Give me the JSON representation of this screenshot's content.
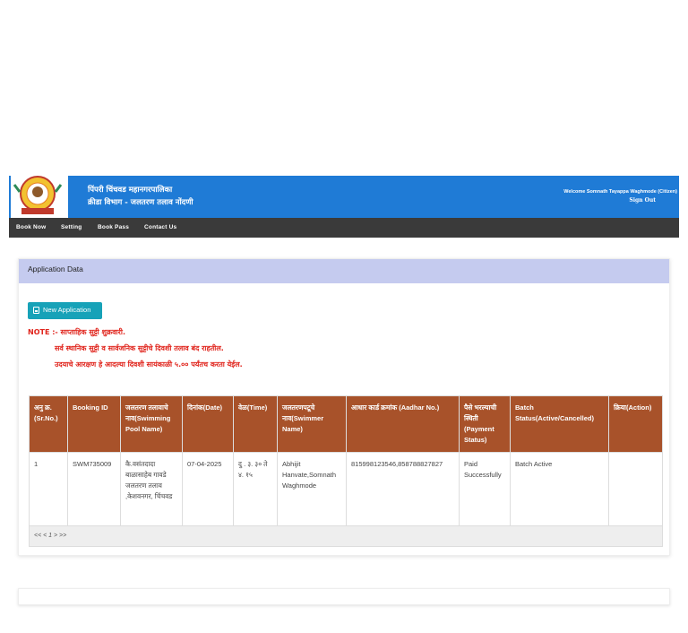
{
  "header": {
    "org_line1": "पिंपरी चिंचवड महानगरपालिका",
    "org_line2": "क्रीडा विभाग - जलतरण तलाव नोंदणी",
    "logo_text": "पिंपरी चिंचवड महानगरपालिका",
    "welcome": "Welcome Somnath Tayappa Waghmode (Citizen)",
    "signout": "Sign Out",
    "color": "#1f7bd6"
  },
  "nav": {
    "items": [
      "Book Now",
      "Setting",
      "Book Pass",
      "Contact Us"
    ],
    "color": "#3a3a3a"
  },
  "card": {
    "title": "Application Data",
    "header_color": "#c5cbef",
    "new_button": "New Application",
    "notes": [
      "NOTE :- साप्ताहिक सुट्टी शुक्रवारी.",
      "सर्व स्थानिक सुट्टी व सार्वजनिक सुट्टीचे दिवशी तलाव बंद राहतील.",
      "उदयाचे आरक्षण हे आदल्या दिवशी सायंकाळी ५.०० पर्यंतच करता येईल."
    ]
  },
  "table": {
    "header_color": "#a8522a",
    "columns": [
      "अनु क्र. (Sr.No.)",
      "Booking ID",
      "जलतरण तलावाचे नाव(Swimming Pool Name)",
      "दिनांक(Date)",
      "वेळ(Time)",
      "जलतरणपटूचे नाव(Swimmer Name)",
      "आधार कार्ड क्रमांक (Aadhar No.)",
      "पैसे भरल्याची स्थिती (Payment Status)",
      "Batch Status(Active/Cancelled)",
      "क्रिया(Action)"
    ],
    "rows": [
      [
        "1",
        "SWM735009",
        "कै.वसंतदादा बाळासाहेब गावडे जलतरण तलाव ,केशवनगर, चिंचवड",
        "07-04-2025",
        "दु . ३. ३० ते ४. १५",
        "Abhijit Hanvate,Somnath Waghmode",
        "815998123546,858788827827",
        "Paid Successfully",
        "Batch Active",
        ""
      ]
    ],
    "pager": "<< < 1 > >>"
  }
}
